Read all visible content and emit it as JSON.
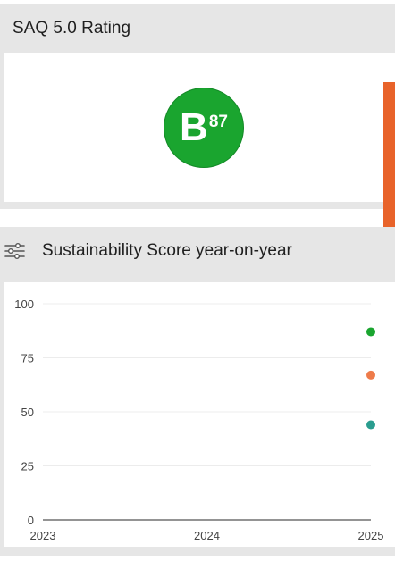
{
  "rating_panel": {
    "title": "SAQ 5.0 Rating",
    "grade": "B",
    "score": "87",
    "badge_color": "#1aa52f"
  },
  "side_tab_color": "#e8632a",
  "score_panel": {
    "title": "Sustainability Score year-on-year",
    "filter_icon": "sliders-icon"
  },
  "chart_data": {
    "type": "scatter",
    "x": [
      "2023",
      "2024",
      "2025"
    ],
    "y_ticks": [
      0,
      25,
      50,
      75,
      100
    ],
    "ylim": [
      0,
      100
    ],
    "grid": true,
    "series": [
      {
        "color": "#1aa52f",
        "points": [
          {
            "x": "2025",
            "y": 87
          }
        ]
      },
      {
        "color": "#ee7b4a",
        "points": [
          {
            "x": "2025",
            "y": 67
          }
        ]
      },
      {
        "color": "#2a9d8f",
        "points": [
          {
            "x": "2025",
            "y": 44
          }
        ]
      }
    ]
  }
}
